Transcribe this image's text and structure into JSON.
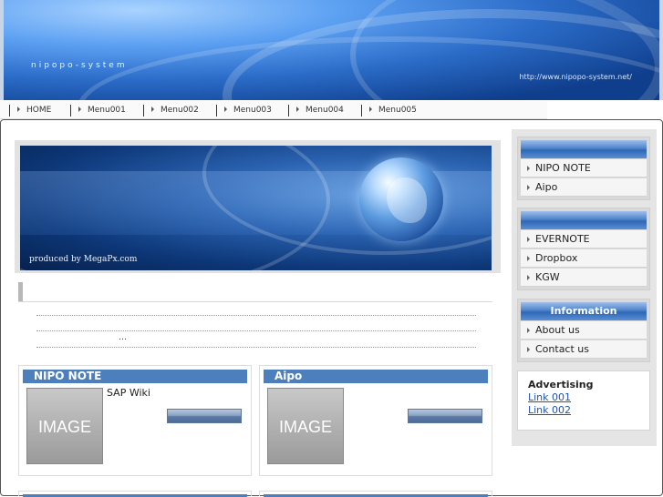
{
  "header": {
    "site_name": "nipopo-system",
    "site_url": "http://www.nipopo-system.net/"
  },
  "nav": {
    "items": [
      {
        "label": "HOME"
      },
      {
        "label": "Menu001"
      },
      {
        "label": "Menu002"
      },
      {
        "label": "Menu003"
      },
      {
        "label": "Menu004"
      },
      {
        "label": "Menu005"
      }
    ]
  },
  "hero": {
    "caption": "produced by MegaPx.com"
  },
  "content": {
    "ellipsis": "…"
  },
  "cards": [
    {
      "title": "NIPO NOTE",
      "image_label": "IMAGE",
      "text": "SAP      Wiki"
    },
    {
      "title": "Aipo",
      "image_label": "IMAGE",
      "text": ""
    }
  ],
  "sidebar": {
    "box1": {
      "heading": "",
      "items": [
        {
          "label": "NIPO NOTE"
        },
        {
          "label": "Aipo"
        }
      ]
    },
    "box2": {
      "heading": "",
      "items": [
        {
          "label": "EVERNOTE"
        },
        {
          "label": "Dropbox"
        },
        {
          "label": "KGW"
        }
      ]
    },
    "box3": {
      "heading": "Information",
      "items": [
        {
          "label": "About us"
        },
        {
          "label": "Contact us"
        }
      ]
    },
    "ads": {
      "title": "Advertising",
      "links": [
        {
          "label": "Link 001"
        },
        {
          "label": "Link 002"
        }
      ]
    }
  },
  "colors": {
    "accent_blue": "#4d7fbd",
    "link_blue": "#2255aa",
    "sidebar_bg": "#e5e5e5"
  }
}
